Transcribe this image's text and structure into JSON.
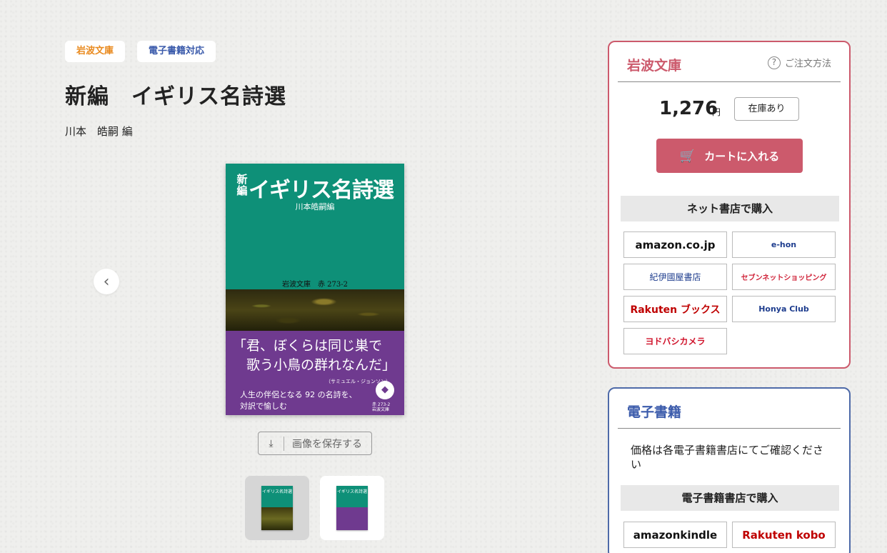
{
  "tags": {
    "publisher": "岩波文庫",
    "ebook": "電子書籍対応"
  },
  "book": {
    "title": "新編　イギリス名詩選",
    "author": "川本　皓嗣 編"
  },
  "cover": {
    "new_label": "新編",
    "title": "イギリス名詩選",
    "editor": "川本皓嗣編",
    "label": "岩波文庫　赤 273-2",
    "quote": "「君、ぼくらは同じ巣で\n　歌う小鳥の群れなんだ」",
    "attribution": "（サミュエル・ジョンソン）",
    "blurb": "人生の伴侶となる 92 の名詩を、\n対訳で愉しむ",
    "logo": "◆",
    "mark": "赤 273-2\n岩波文庫"
  },
  "save_button": {
    "label": "画像を保存する",
    "icon": "download-icon"
  },
  "thumbnails": [
    {
      "title": "イギリス名詩選"
    },
    {
      "title": "イギリス名詩選"
    }
  ],
  "purchase": {
    "title": "岩波文庫",
    "order_link": "ご注文方法",
    "price": "1,276",
    "currency": "円",
    "stock": "在庫あり",
    "cart_button": "カートに入れる",
    "online_heading": "ネット書店で購入",
    "stores": [
      {
        "name": "amazon.co.jp"
      },
      {
        "name": "e-hon"
      },
      {
        "name": "紀伊國屋書店"
      },
      {
        "name": "セブンネットショッピング"
      },
      {
        "name": "Rakuten ブックス"
      },
      {
        "name": "Honya Club"
      },
      {
        "name": "ヨドバシカメラ"
      }
    ]
  },
  "ebook": {
    "title": "電子書籍",
    "note": "価格は各電子書籍書店にてご確認ください",
    "heading": "電子書籍書店で購入",
    "stores": [
      {
        "name": "amazonkindle"
      },
      {
        "name": "Rakuten kobo"
      }
    ]
  },
  "colors": {
    "accent_red": "#cc5a6c",
    "accent_blue": "#3b5bab",
    "cover_green": "#0e9078",
    "cover_purple": "#6f3a8f"
  }
}
